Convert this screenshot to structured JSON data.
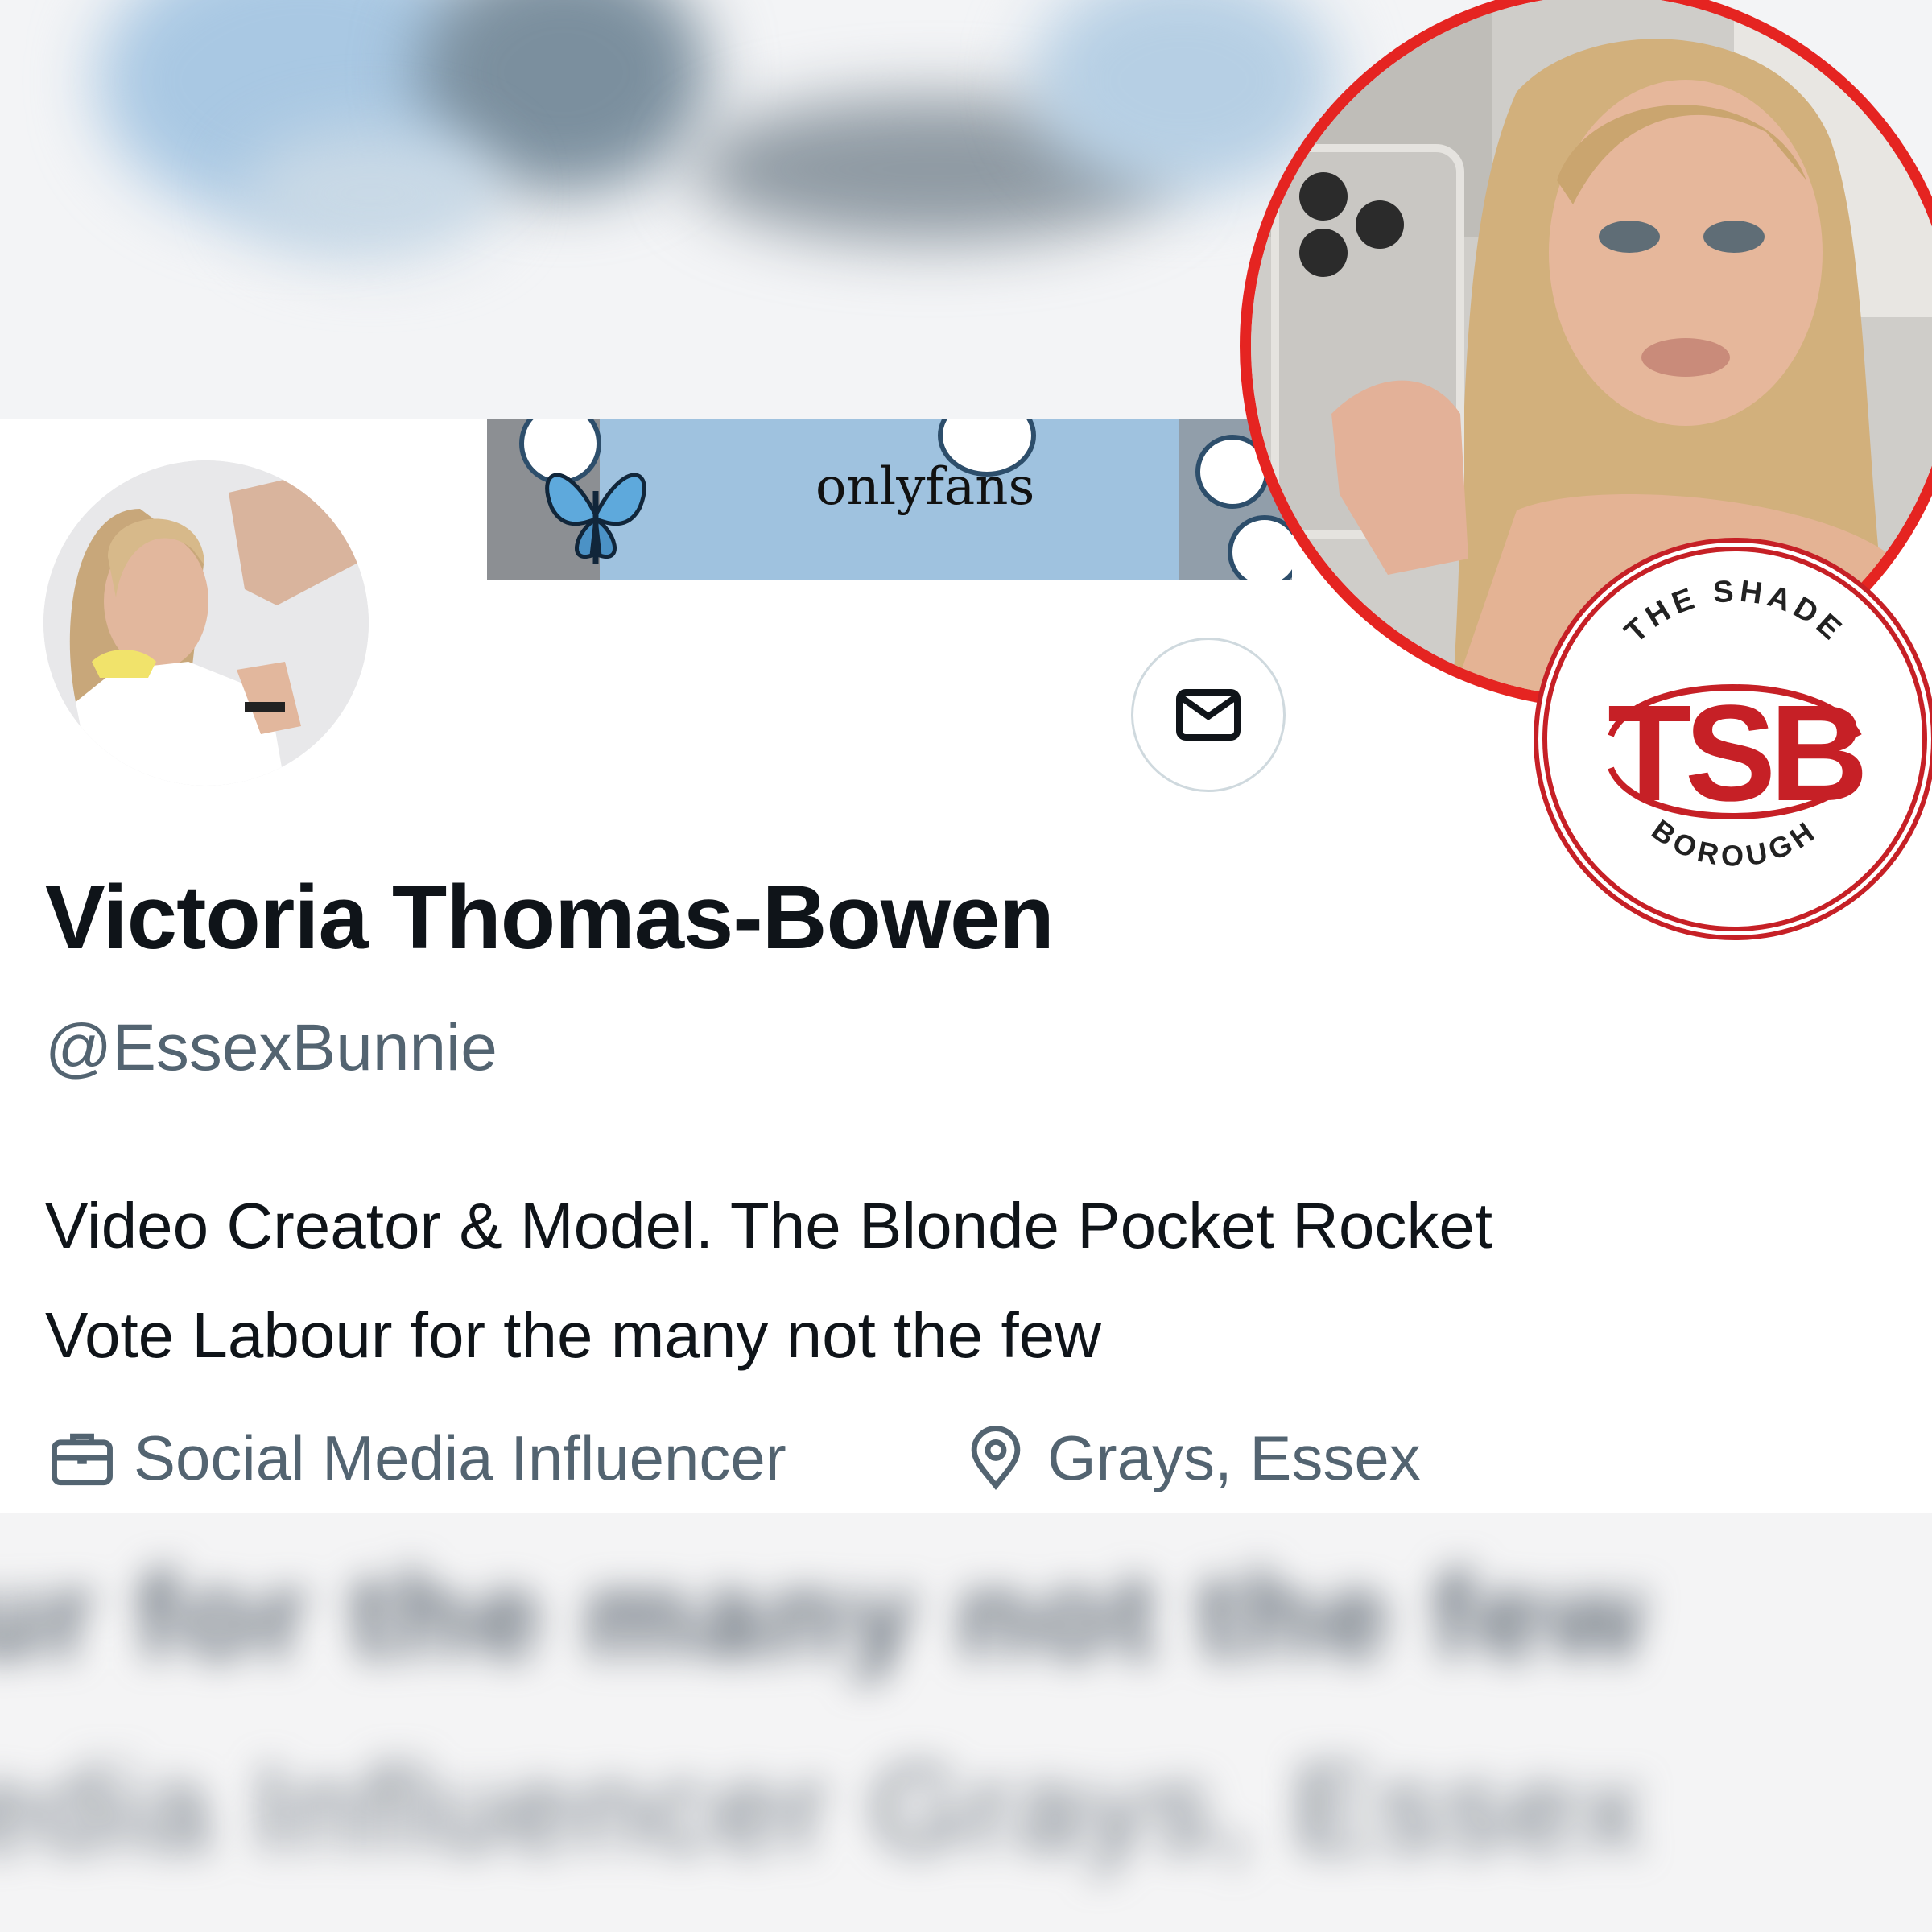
{
  "banner": {
    "text": "onlyfans"
  },
  "profile": {
    "display_name": "Victoria Thomas-Bowen",
    "handle": "@EssexBunnie",
    "bio_lines": [
      "Video Creator & Model. The Blonde Pocket Rocket",
      "Vote Labour for the many not the few"
    ],
    "occupation": "Social Media Influencer",
    "location": "Grays, Essex"
  },
  "blurred_text": {
    "line1": "ur for the many not the few",
    "line2": "edia Influencer   Grays, Essex"
  },
  "logo": {
    "top_text": "THE SHADE",
    "monogram": "TSB",
    "bottom_text": "BOROUGH"
  },
  "icons": {
    "message": "mail-icon",
    "occupation": "briefcase-icon",
    "location": "location-pin-icon"
  },
  "colors": {
    "accent_red": "#e52421",
    "logo_red": "#c62026",
    "text_primary": "#0f1419",
    "text_secondary": "#536471"
  }
}
